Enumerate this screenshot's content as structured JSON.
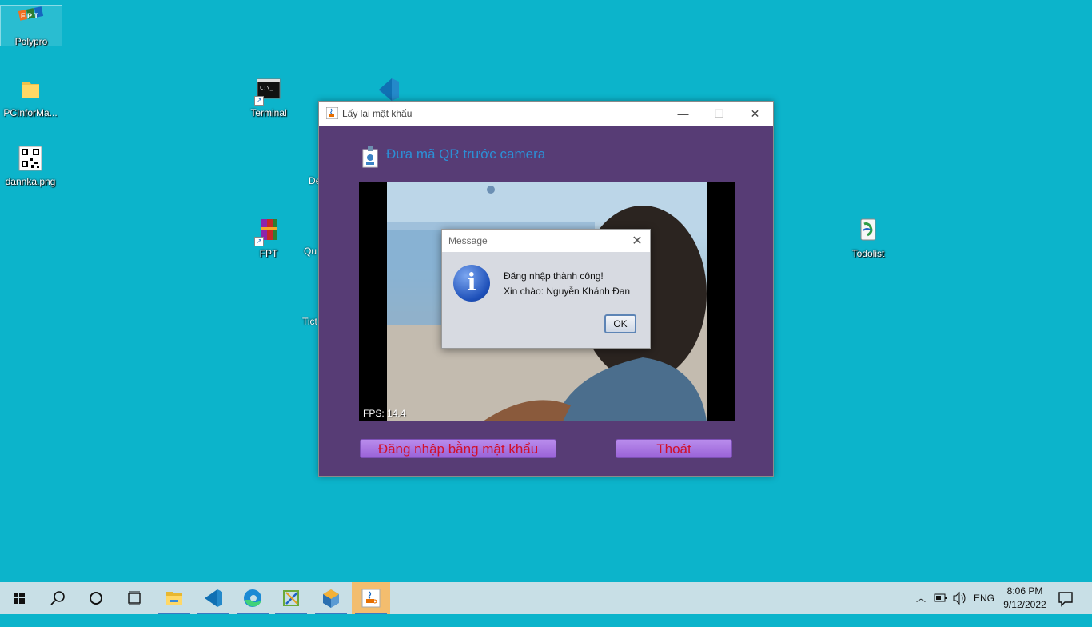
{
  "desktop": {
    "icons": [
      {
        "label": "Polypro"
      },
      {
        "label": "PCInforMa..."
      },
      {
        "label": "dannka.png"
      },
      {
        "label": "Terminal"
      },
      {
        "label": "FPT"
      },
      {
        "label": "Todolist"
      },
      {
        "label": "De"
      },
      {
        "label": "Qu"
      },
      {
        "label": "Tict"
      }
    ]
  },
  "window": {
    "title": "Lấy lại mật khẩu",
    "minimize": "—",
    "maximize": "☐",
    "close": "✕",
    "heading": "Đưa mã QR trước camera",
    "fps": "FPS: 14.4",
    "login_password_button": "Đăng nhập bằng mật khẩu",
    "exit_button": "Thoát"
  },
  "dialog": {
    "title": "Message",
    "line1": "Đăng nhập thành công!",
    "line2": "Xin chào: Nguyễn Khánh Đan",
    "ok": "OK",
    "close": "✕"
  },
  "taskbar": {
    "language": "ENG",
    "time": "8:06 PM",
    "date": "9/12/2022"
  },
  "colors": {
    "desktop": "#0cb4cb",
    "window_client": "#573c75",
    "heading": "#2c8fd6",
    "button_text": "#d1102b"
  }
}
